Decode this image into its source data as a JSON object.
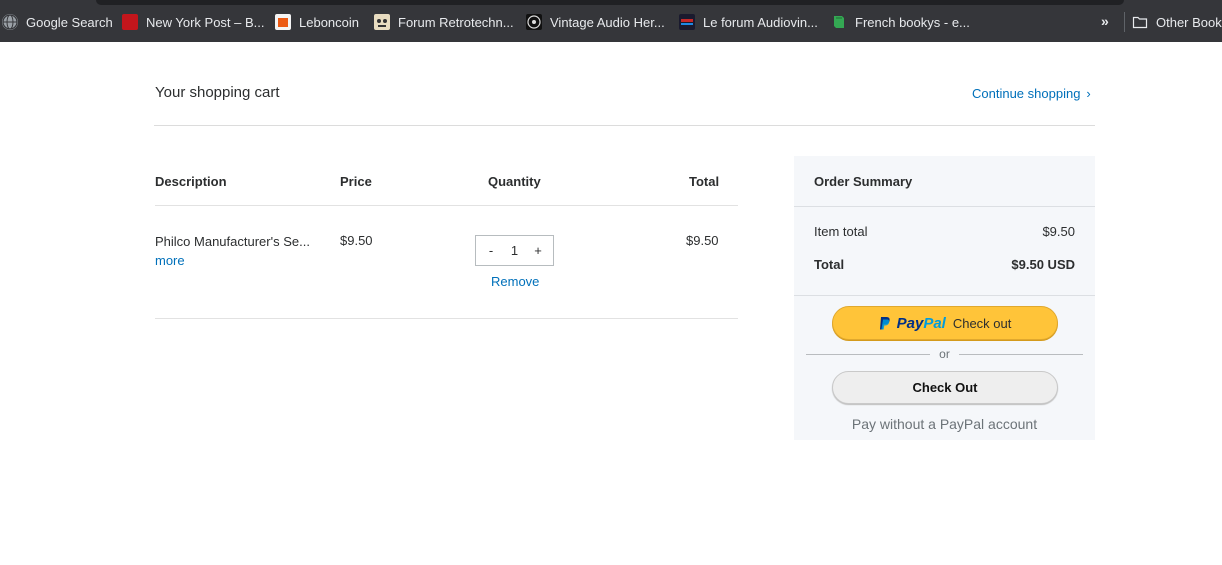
{
  "bookmarks": {
    "items": [
      {
        "label": "Google Search",
        "icon": "globe-icon",
        "color": "#9aa0a6"
      },
      {
        "label": "New York Post – B...",
        "icon": "nypost-icon",
        "color": "#c4161c"
      },
      {
        "label": "Leboncoin",
        "icon": "leboncoin-icon",
        "color": "#ec5a13"
      },
      {
        "label": "Forum Retrotechn...",
        "icon": "forum-retro-icon",
        "color": "#e8dcc0"
      },
      {
        "label": "Vintage Audio Her...",
        "icon": "vintage-audio-icon",
        "color": "#111111"
      },
      {
        "label": "Le forum Audiovin...",
        "icon": "audiovintage-icon",
        "color": "#1a1a2e"
      },
      {
        "label": "French bookys - e...",
        "icon": "book-icon",
        "color": "#34a853"
      }
    ],
    "overflow_label": "»",
    "other_label": "Other Bookm"
  },
  "cart": {
    "title": "Your shopping cart",
    "continue_label": "Continue shopping",
    "continue_chevron": "›",
    "columns": {
      "description": "Description",
      "price": "Price",
      "quantity": "Quantity",
      "total": "Total"
    },
    "items": [
      {
        "name": "Philco Manufacturer's Se...",
        "more_label": "more",
        "price": "$9.50",
        "quantity": "1",
        "decrement": "-",
        "increment": "+",
        "remove_label": "Remove",
        "total": "$9.50"
      }
    ]
  },
  "summary": {
    "title": "Order Summary",
    "item_total_label": "Item total",
    "item_total_value": "$9.50",
    "total_label": "Total",
    "total_value": "$9.50 USD",
    "paypal_pay": "Pay",
    "paypal_pal": "Pal",
    "paypal_checkout": "Check out",
    "or_label": "or",
    "checkout_label": "Check Out",
    "pay_without": "Pay without a PayPal account"
  },
  "colors": {
    "link": "#0070ba",
    "paypal_yellow": "#ffc439",
    "paypal_dark_blue": "#003087",
    "paypal_light_blue": "#009cde"
  }
}
